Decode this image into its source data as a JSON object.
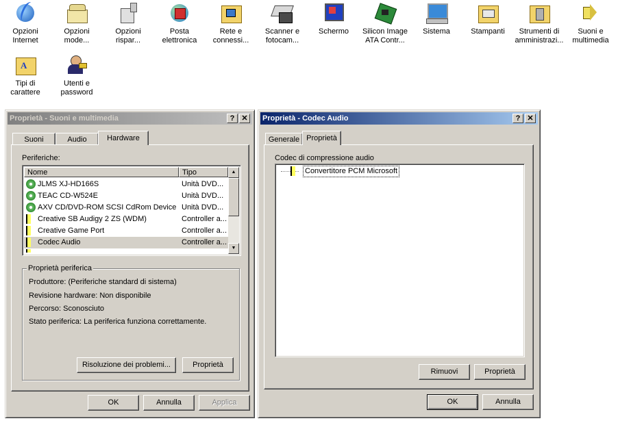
{
  "desktop_icons": [
    {
      "name": "opzioni-internet-icon",
      "line1": "Opzioni",
      "line2": "Internet"
    },
    {
      "name": "opzioni-modem-icon",
      "line1": "Opzioni",
      "line2": "mode..."
    },
    {
      "name": "opzioni-risparmio-icon",
      "line1": "Opzioni",
      "line2": "rispar..."
    },
    {
      "name": "posta-elettronica-icon",
      "line1": "Posta",
      "line2": "elettronica"
    },
    {
      "name": "rete-connessioni-icon",
      "line1": "Rete e",
      "line2": "connessi..."
    },
    {
      "name": "scanner-fotocamere-icon",
      "line1": "Scanner e",
      "line2": "fotocam..."
    },
    {
      "name": "schermo-icon",
      "line1": "Schermo",
      "line2": ""
    },
    {
      "name": "silicon-image-icon",
      "line1": "Silicon Image",
      "line2": "ATA Contr..."
    },
    {
      "name": "sistema-icon",
      "line1": "Sistema",
      "line2": ""
    },
    {
      "name": "stampanti-icon",
      "line1": "Stampanti",
      "line2": ""
    },
    {
      "name": "strumenti-amministrazione-icon",
      "line1": "Strumenti di",
      "line2": "amministrazi..."
    },
    {
      "name": "suoni-multimedia-icon",
      "line1": "Suoni e",
      "line2": "multimedia"
    },
    {
      "name": "tipi-carattere-icon",
      "line1": "Tipi di",
      "line2": "carattere"
    },
    {
      "name": "utenti-password-icon",
      "line1": "Utenti e",
      "line2": "password"
    }
  ],
  "left_dialog": {
    "title": "Proprietà - Suoni e multimedia",
    "tabs": [
      "Suoni",
      "Audio",
      "Hardware"
    ],
    "devices_label": "Periferiche:",
    "columns": [
      "Nome",
      "Tipo"
    ],
    "devices": [
      {
        "name": "JLMS XJ-HD166S",
        "type": "Unità DVD..."
      },
      {
        "name": "TEAC CD-W524E",
        "type": "Unità DVD..."
      },
      {
        "name": "AXV CD/DVD-ROM SCSI CdRom Device",
        "type": "Unità DVD..."
      },
      {
        "name": "Creative SB Audigy 2 ZS (WDM)",
        "type": "Controller a..."
      },
      {
        "name": "Creative Game Port",
        "type": "Controller a..."
      },
      {
        "name": "Codec Audio",
        "type": "Controller a..."
      }
    ],
    "group_label": "Proprietà periferica",
    "props": [
      "Produttore: (Periferiche standard di sistema)",
      "Revisione hardware: Non disponibile",
      "Percorso: Sconosciuto",
      "Stato periferica: La periferica funziona correttamente."
    ],
    "btn_troubleshoot": "Risoluzione dei problemi...",
    "btn_properties": "Proprietà",
    "btn_ok": "OK",
    "btn_cancel": "Annulla",
    "btn_apply": "Applica"
  },
  "right_dialog": {
    "title": "Proprietà - Codec Audio",
    "tabs": [
      "Generale",
      "Proprietà"
    ],
    "list_label": "Codec di compressione audio",
    "codec_item": "Convertitore PCM Microsoft",
    "btn_remove": "Rimuovi",
    "btn_properties": "Proprietà",
    "btn_ok": "OK",
    "btn_cancel": "Annulla"
  },
  "title_buttons": {
    "help": "?",
    "close": "✕"
  }
}
